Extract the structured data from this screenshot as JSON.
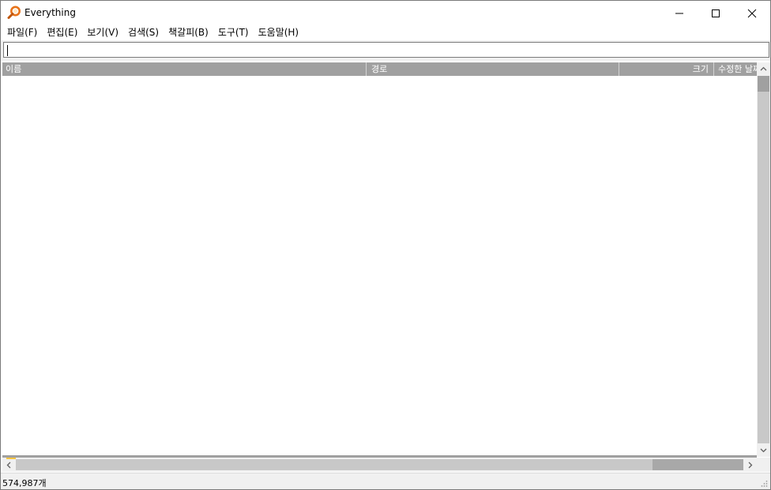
{
  "window": {
    "title": "Everything"
  },
  "menu": {
    "items": [
      "파일(F)",
      "편집(E)",
      "보기(V)",
      "검색(S)",
      "책갈피(B)",
      "도구(T)",
      "도움말(H)"
    ]
  },
  "search": {
    "value": ""
  },
  "columns": {
    "name": "이름",
    "path": "경로",
    "size": "크기",
    "modified": "수정한 날짜"
  },
  "status": {
    "count": "574,987개"
  },
  "colors": {
    "header_bg": "#a0a0a0",
    "icon_orange": "#e8731a"
  }
}
